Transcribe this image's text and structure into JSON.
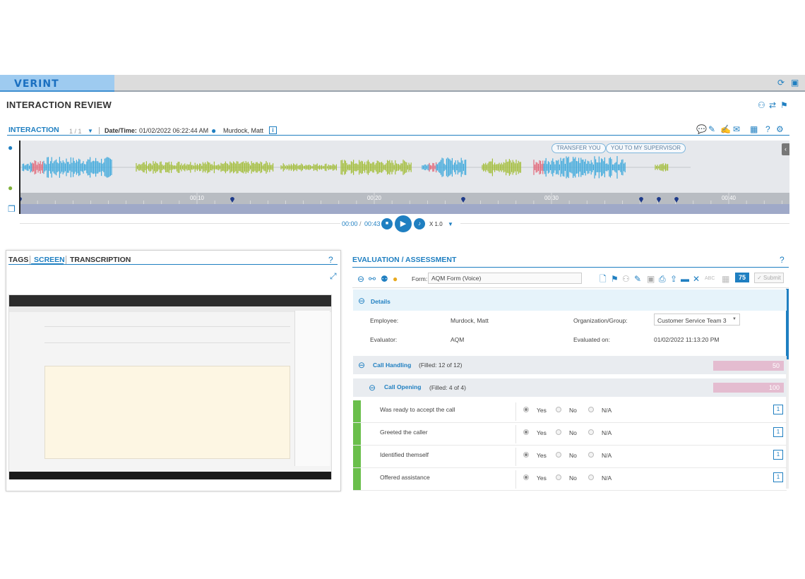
{
  "app": {
    "brand": "VERINT",
    "page_title": "INTERACTION REVIEW",
    "colors": {
      "accent": "#1f7fc1",
      "green": "#6abf4b",
      "pink_score": "#e4bcd0",
      "wave_blue": "#3fa9dc",
      "wave_green": "#a3be3a",
      "wave_red": "#e2687a"
    }
  },
  "interaction": {
    "tab_label": "INTERACTION",
    "pager": "1 / 1",
    "date_label": "Date/Time:",
    "date_value": "01/02/2022 06:22:44 AM",
    "agent_name": "Murdock, Matt",
    "bubbles": [
      "TRANSFER YOU",
      "YOU TO MY SUPERVISOR"
    ],
    "ticks": [
      "00:10",
      "00:20",
      "00:30",
      "00:40"
    ]
  },
  "player": {
    "current": "00:00",
    "separator": "/",
    "total": "00:43",
    "speed": "X 1.0"
  },
  "left_panel": {
    "tabs": [
      "TAGS",
      "SCREEN",
      "TRANSCRIPTION"
    ],
    "active_tab": "SCREEN"
  },
  "evaluation": {
    "title": "EVALUATION / ASSESSMENT",
    "form_label": "Form:",
    "form_value": "AQM Form (Voice)",
    "total_score": "75",
    "submit_label": "✓ Submit",
    "details_title": "Details",
    "employee_label": "Employee:",
    "employee_value": "Murdock, Matt",
    "org_label": "Organization/Group:",
    "org_value": "Customer Service Team 3",
    "evaluator_label": "Evaluator:",
    "evaluator_value": "AQM",
    "evaluated_label": "Evaluated on:",
    "evaluated_value": "01/02/2022 11:13:20 PM",
    "sections": [
      {
        "name": "Call Handling",
        "filled": "(Filled: 12 of 12)",
        "score": "50"
      },
      {
        "name": "Call Opening",
        "filled": "(Filled: 4 of 4)",
        "score": "100"
      }
    ],
    "options": [
      "Yes",
      "No",
      "N/A"
    ],
    "questions": [
      {
        "text": "Was ready to accept the call",
        "answer": "Yes",
        "comments": "1"
      },
      {
        "text": "Greeted the caller",
        "answer": "Yes",
        "comments": "1"
      },
      {
        "text": "Identified themself",
        "answer": "Yes",
        "comments": "1"
      },
      {
        "text": "Offered assistance",
        "answer": "Yes",
        "comments": "1"
      }
    ]
  }
}
